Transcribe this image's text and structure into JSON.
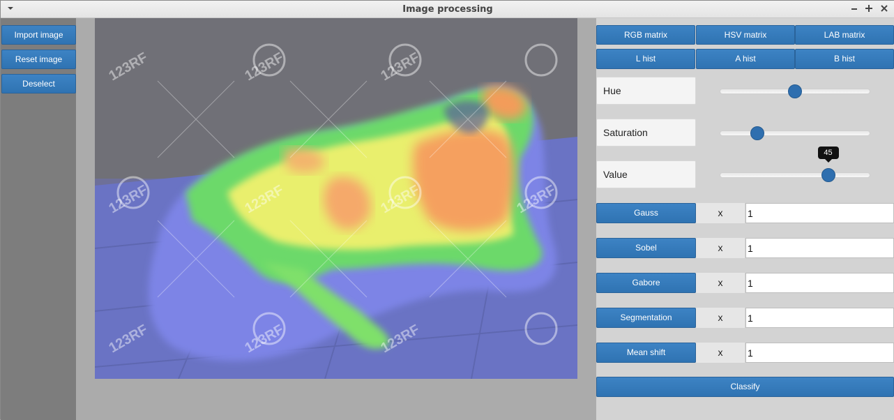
{
  "window": {
    "title": "Image processing",
    "menu_icon": "chevron-down-icon",
    "minimize_icon": "minimize-icon",
    "maximize_icon": "maximize-icon",
    "close_icon": "close-icon"
  },
  "left_panel": {
    "buttons": [
      "Import image",
      "Reset image",
      "Deselect"
    ]
  },
  "image": {
    "watermark_text": "123RF"
  },
  "right_panel": {
    "matrix_buttons": [
      "RGB matrix",
      "HSV matrix",
      "LAB matrix"
    ],
    "hist_buttons": [
      "L hist",
      "A hist",
      "B hist"
    ],
    "sliders": [
      {
        "label": "Hue",
        "value": 0.5
      },
      {
        "label": "Saturation",
        "value": 0.25
      },
      {
        "label": "Value",
        "value": 0.72,
        "tooltip": "45"
      }
    ],
    "filters": [
      {
        "label": "Gauss",
        "x": "x",
        "value": "1"
      },
      {
        "label": "Sobel",
        "x": "x",
        "value": "1"
      },
      {
        "label": "Gabore",
        "x": "x",
        "value": "1"
      },
      {
        "label": "Segmentation",
        "x": "x",
        "value": "1"
      },
      {
        "label": "Mean shift",
        "x": "x",
        "value": "1"
      }
    ],
    "classify_button": "Classify"
  },
  "colors": {
    "button_blue": "#3178b8",
    "slider_knob": "#2f6faf",
    "panel_gray": "#d3d3d3",
    "left_panel_gray": "#7d7d7d"
  }
}
